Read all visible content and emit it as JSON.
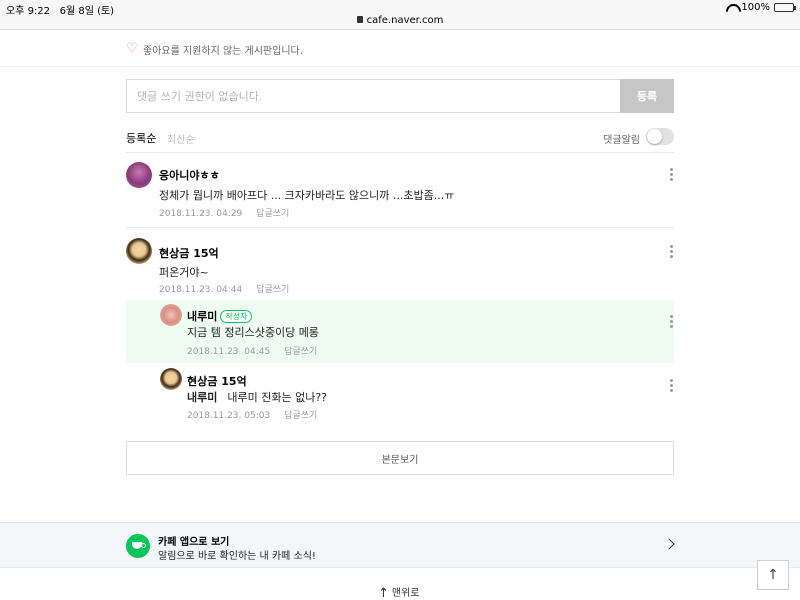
{
  "status_bar": {
    "time": "오후 9:22",
    "date": "6월 8일 (토)",
    "url": "cafe.naver.com",
    "battery": "100%",
    "battery_level": 1.0
  },
  "like_notice": "좋아요를 지원하지 않는 게시판입니다.",
  "comment_input": {
    "placeholder": "댓글 쓰기 권한이 없습니다.",
    "submit_label": "등록"
  },
  "sort": {
    "options": [
      "등록순",
      "최신순"
    ],
    "selected": "등록순",
    "notify_label": "댓글알림",
    "notify_on": false
  },
  "comments": [
    {
      "nickname": "응아니야ㅎㅎ",
      "text": "정체가 뭡니까 배아프다 ... 크자카바라도 않으니까 ...초밥좀...ㅠ",
      "date": "2018.11.23. 04:29",
      "reply_label": "답글쓰기"
    },
    {
      "nickname": "현상금 15억",
      "text": "퍼온거야~",
      "date": "2018.11.23. 04:44",
      "reply_label": "답글쓰기"
    },
    {
      "nickname": "내루미",
      "badge": "작성자",
      "text": "지금 템 정리스샷중이당 메롱",
      "date": "2018.11.23. 04:45",
      "reply_label": "답글쓰기"
    },
    {
      "nickname": "현상금 15억",
      "mention": "내루미",
      "text": "내루미 진화는 없나??",
      "date": "2018.11.23. 05:03",
      "reply_label": "답글쓰기"
    }
  ],
  "view_article_label": "본문보기",
  "app_banner": {
    "title": "카페 앱으로 보기",
    "description": "알림으로 바로 확인하는 내 카페 소식!"
  },
  "go_top_label": "맨위로",
  "colors": {
    "brand_green": "#03c75a",
    "highlight_bg": "#effcf2",
    "heart": "#f47b8f",
    "submit_disabled": "#c6c6c6"
  },
  "icons": [
    "lock-icon",
    "wifi-icon",
    "battery-icon",
    "heart-icon",
    "more-icon",
    "chevron-right-icon",
    "arrow-up-icon",
    "cafe-app-icon"
  ]
}
